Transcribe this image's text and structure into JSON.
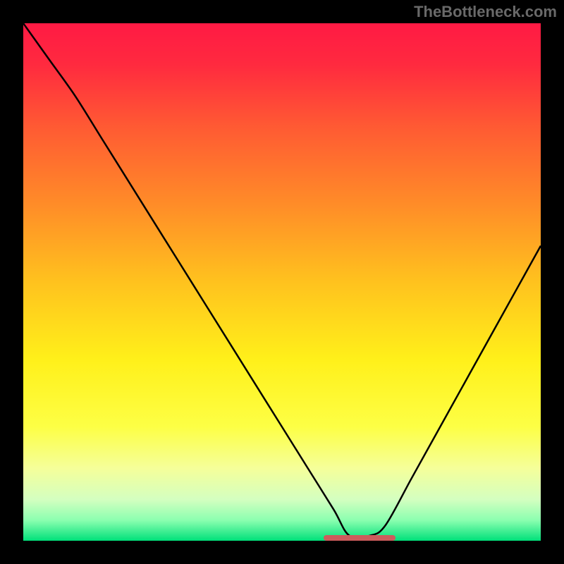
{
  "watermark": "TheBottleneck.com",
  "chart_data": {
    "type": "line",
    "title": "",
    "xlabel": "",
    "ylabel": "",
    "xlim": [
      0,
      100
    ],
    "ylim": [
      0,
      100
    ],
    "background_gradient": {
      "stops": [
        {
          "offset": 0.0,
          "color": "#ff1a44"
        },
        {
          "offset": 0.08,
          "color": "#ff2a3f"
        },
        {
          "offset": 0.2,
          "color": "#ff5a33"
        },
        {
          "offset": 0.35,
          "color": "#ff8c28"
        },
        {
          "offset": 0.5,
          "color": "#ffc21e"
        },
        {
          "offset": 0.65,
          "color": "#fff01a"
        },
        {
          "offset": 0.78,
          "color": "#fdff45"
        },
        {
          "offset": 0.86,
          "color": "#f5ff9a"
        },
        {
          "offset": 0.92,
          "color": "#d4ffc0"
        },
        {
          "offset": 0.96,
          "color": "#8cffb0"
        },
        {
          "offset": 1.0,
          "color": "#00e07a"
        }
      ]
    },
    "series": [
      {
        "name": "bottleneck-curve",
        "type": "line",
        "color": "#000000",
        "x": [
          0,
          5,
          10,
          15,
          20,
          25,
          30,
          35,
          40,
          45,
          50,
          55,
          60,
          63,
          67,
          70,
          75,
          80,
          85,
          90,
          95,
          100
        ],
        "y": [
          100,
          93,
          86,
          78,
          70,
          62,
          54,
          46,
          38,
          30,
          22,
          14,
          6,
          1,
          1,
          3,
          12,
          21,
          30,
          39,
          48,
          57
        ]
      }
    ],
    "annotations": [
      {
        "name": "optimal-marker",
        "type": "segment",
        "color": "#cd5c5c",
        "x_start": 58,
        "x_end": 72,
        "y": 0.5
      }
    ]
  }
}
